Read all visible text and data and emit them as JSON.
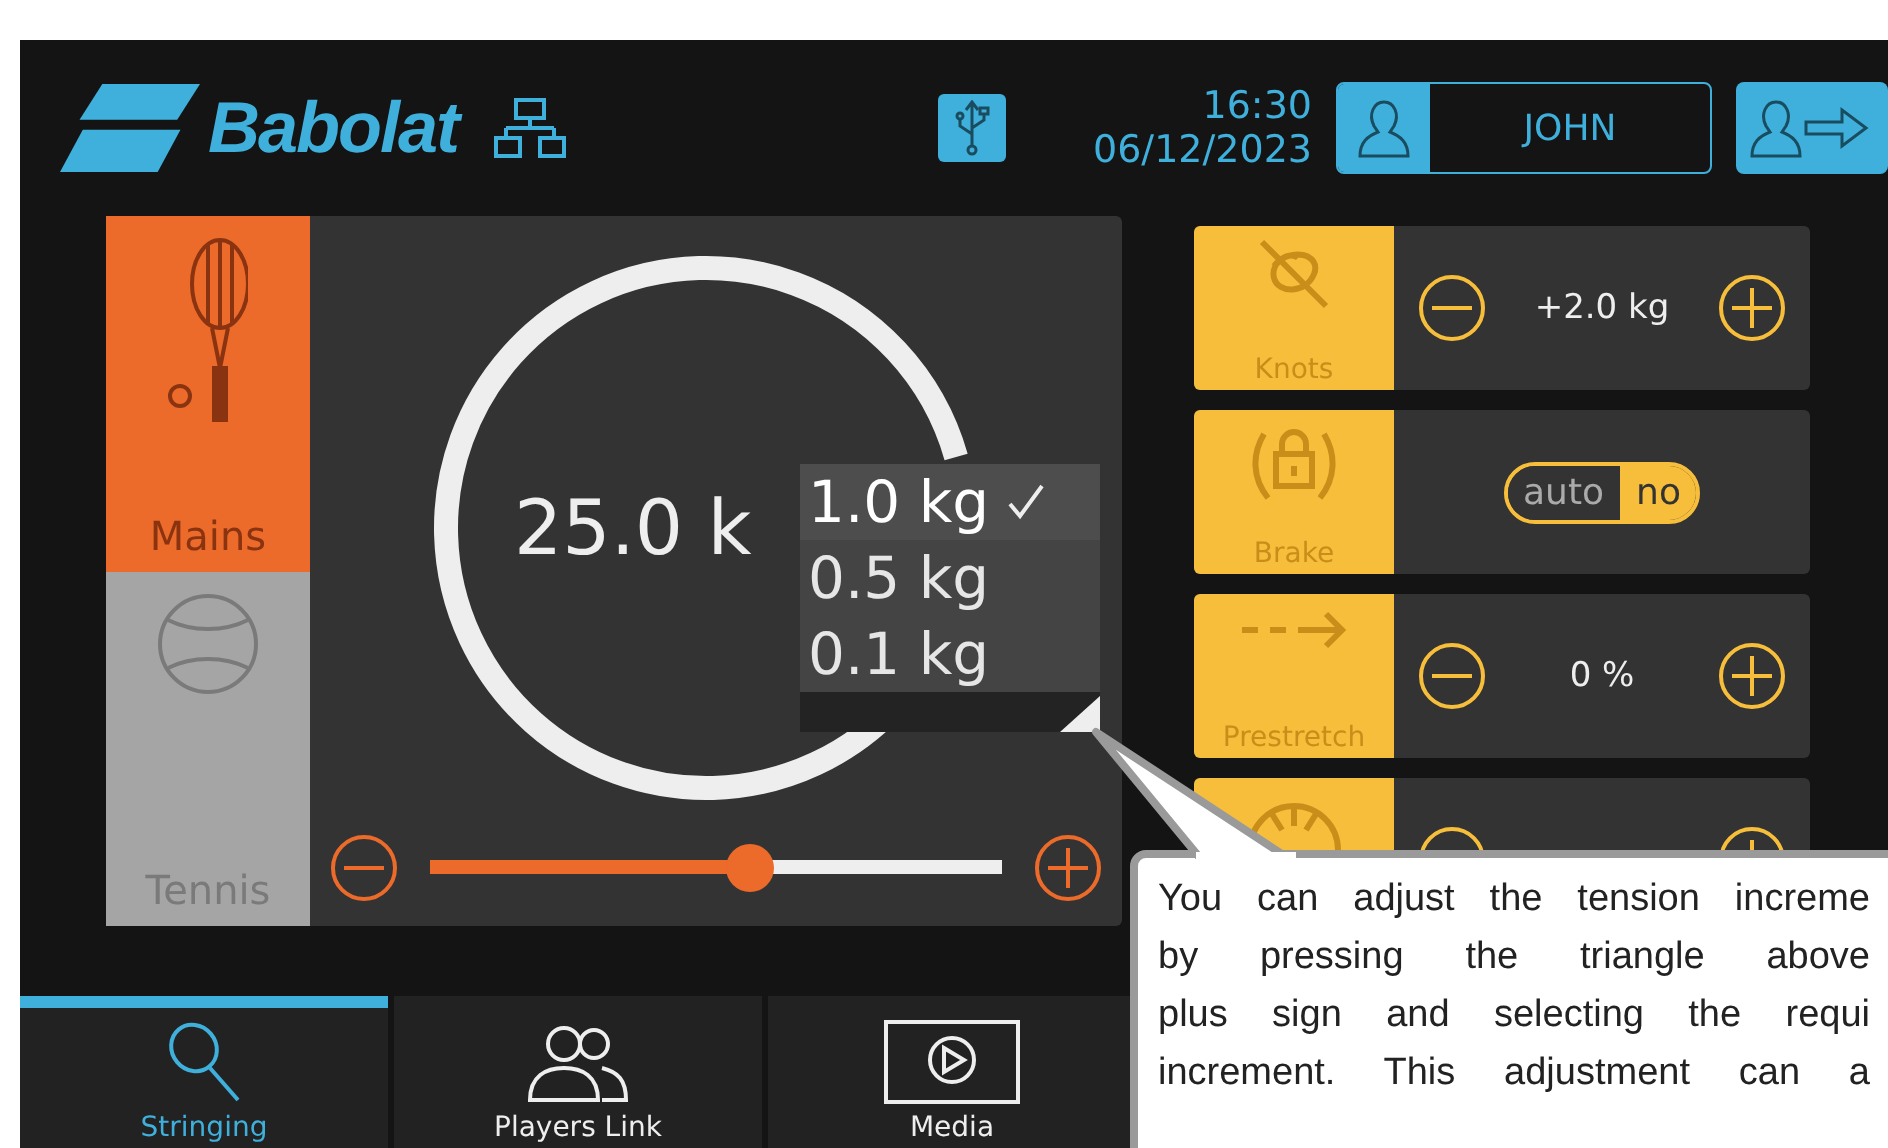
{
  "header": {
    "logo": "Babolat",
    "time": "16:30",
    "date": "06/12/2023",
    "user": "JOHN"
  },
  "side_tabs": [
    {
      "label": "Mains",
      "selected": true
    },
    {
      "label": "Tennis",
      "selected": false
    }
  ],
  "tension": {
    "value": "25.0 k",
    "level": 0.56
  },
  "increment_menu": [
    {
      "label": "1.0 kg",
      "selected": true
    },
    {
      "label": "0.5 kg",
      "selected": false
    },
    {
      "label": "0.1 kg",
      "selected": false
    }
  ],
  "settings": [
    {
      "kind": "stepper",
      "label": "Knots",
      "value": "+2.0 kg"
    },
    {
      "kind": "toggle",
      "label": "Brake",
      "options": [
        {
          "label": "auto",
          "selected": false
        },
        {
          "label": "no",
          "selected": true
        }
      ]
    },
    {
      "kind": "stepper",
      "label": "Prestretch",
      "value": "0 %"
    },
    {
      "kind": "partial"
    }
  ],
  "nav": [
    {
      "label": "Stringing",
      "selected": true
    },
    {
      "label": "Players Link",
      "selected": false
    },
    {
      "label": "Media",
      "selected": false
    }
  ],
  "callout": {
    "lines": [
      "You can adjust the tension increme",
      "by pressing the triangle above",
      "plus sign and selecting the requi",
      "increment. This adjustment can a"
    ]
  }
}
